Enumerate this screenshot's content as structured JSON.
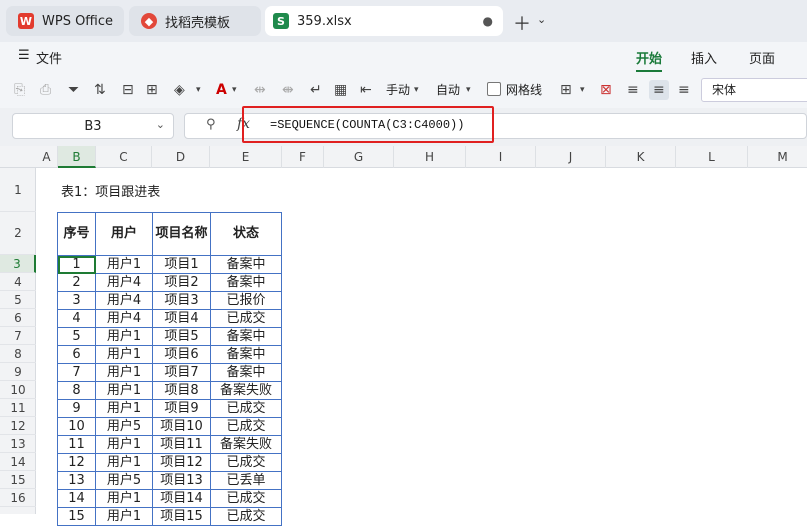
{
  "tabs": [
    {
      "label": "WPS Office",
      "icon": "wps-logo-icon"
    },
    {
      "label": "找稻壳模板",
      "icon": "docer-logo-icon"
    },
    {
      "label": "359.xlsx",
      "icon": "spreadsheet-file-icon",
      "icon_text": "S"
    }
  ],
  "menu": {
    "file_label": "文件",
    "ribbon_tabs": [
      "开始",
      "插入",
      "页面"
    ],
    "active_tab": "开始"
  },
  "toolbar": {
    "manual_label": "手动",
    "auto_label": "自动",
    "gridlines_label": "网格线",
    "font_name": "宋体"
  },
  "formula_bar": {
    "cell_ref": "B3",
    "fx_label": "fx",
    "formula": "=SEQUENCE(COUNTA(C3:C4000))"
  },
  "columns": [
    "A",
    "B",
    "C",
    "D",
    "E",
    "F",
    "G",
    "H",
    "I",
    "J",
    "K",
    "L",
    "M"
  ],
  "active_column": "B",
  "rows": [
    "1",
    "2",
    "3",
    "4",
    "5",
    "6",
    "7",
    "8",
    "9",
    "10",
    "11",
    "12",
    "13",
    "14",
    "15",
    "16"
  ],
  "active_row": "3",
  "sheet": {
    "title": "表1：项目跟进表",
    "headers": [
      "序号",
      "用户",
      "项目名称",
      "状态"
    ],
    "records": [
      [
        "1",
        "用户1",
        "项目1",
        "备案中"
      ],
      [
        "2",
        "用户4",
        "项目2",
        "备案中"
      ],
      [
        "3",
        "用户4",
        "项目3",
        "已报价"
      ],
      [
        "4",
        "用户4",
        "项目4",
        "已成交"
      ],
      [
        "5",
        "用户1",
        "项目5",
        "备案中"
      ],
      [
        "6",
        "用户1",
        "项目6",
        "备案中"
      ],
      [
        "7",
        "用户1",
        "项目7",
        "备案中"
      ],
      [
        "8",
        "用户1",
        "项目8",
        "备案失败"
      ],
      [
        "9",
        "用户1",
        "项目9",
        "已成交"
      ],
      [
        "10",
        "用户5",
        "项目10",
        "已成交"
      ],
      [
        "11",
        "用户1",
        "项目11",
        "备案失败"
      ],
      [
        "12",
        "用户1",
        "项目12",
        "已成交"
      ],
      [
        "13",
        "用户5",
        "项目13",
        "已丢单"
      ],
      [
        "14",
        "用户1",
        "项目14",
        "已成交"
      ],
      [
        "15",
        "用户1",
        "项目15",
        "已成交"
      ]
    ]
  },
  "colors": {
    "accent": "#1a7a3a",
    "highlight_box": "#e02020",
    "table_border": "#4472c4"
  }
}
